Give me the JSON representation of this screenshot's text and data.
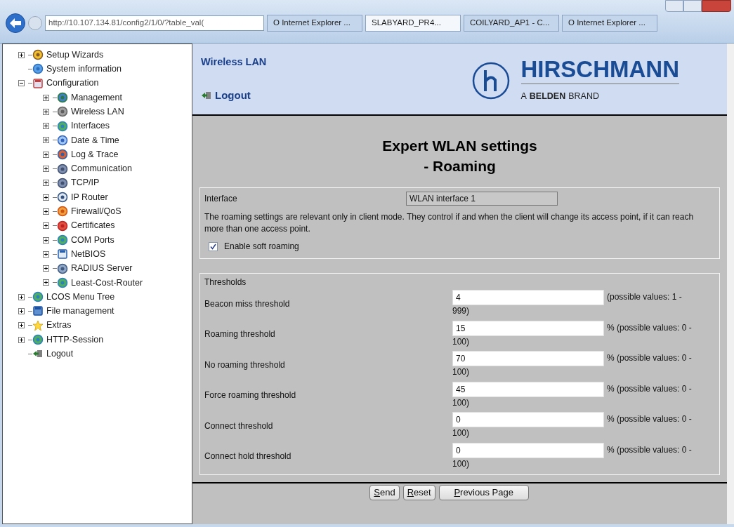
{
  "browser": {
    "address": "http://10.107.134.81/config2/1/0/?table_val(",
    "tabs": [
      {
        "label": "O Internet Explorer ...",
        "selected": false
      },
      {
        "label": "SLABYARD_PR4...",
        "selected": true
      },
      {
        "label": "COILYARD_AP1 - C...",
        "selected": false
      },
      {
        "label": "O Internet Explorer ...",
        "selected": false
      }
    ]
  },
  "sidebar": {
    "items": [
      {
        "label": "Setup Wizards",
        "expanded": false
      },
      {
        "label": "System information"
      },
      {
        "label": "Configuration",
        "expanded": true,
        "children": [
          {
            "label": "Management",
            "expanded": false
          },
          {
            "label": "Wireless LAN",
            "expanded": false
          },
          {
            "label": "Interfaces",
            "expanded": false
          },
          {
            "label": "Date & Time",
            "expanded": false
          },
          {
            "label": "Log & Trace",
            "expanded": false
          },
          {
            "label": "Communication",
            "expanded": false
          },
          {
            "label": "TCP/IP",
            "expanded": false
          },
          {
            "label": "IP Router",
            "expanded": false
          },
          {
            "label": "Firewall/QoS",
            "expanded": false
          },
          {
            "label": "Certificates",
            "expanded": false
          },
          {
            "label": "COM Ports",
            "expanded": false
          },
          {
            "label": "NetBIOS",
            "expanded": false
          },
          {
            "label": "RADIUS Server",
            "expanded": false
          },
          {
            "label": "Least-Cost-Router",
            "expanded": false
          }
        ]
      },
      {
        "label": "LCOS Menu Tree",
        "expanded": false
      },
      {
        "label": "File management",
        "expanded": false
      },
      {
        "label": "Extras",
        "expanded": false
      },
      {
        "label": "HTTP-Session",
        "expanded": false
      },
      {
        "label": "Logout"
      }
    ]
  },
  "header": {
    "section": "Wireless LAN",
    "logout": "Logout",
    "brand": "HIRSCHMANN",
    "tagline_prefix": "A",
    "tagline_bold": "BELDEN",
    "tagline_suffix": "BRAND"
  },
  "page": {
    "title_line_1": "Expert WLAN settings",
    "title_line_2": "- Roaming",
    "interface": {
      "label": "Interface",
      "value": "WLAN interface 1"
    },
    "description": "The roaming settings are relevant only in client mode. They control if and when the client will change its access point, if it can reach more than one access point.",
    "soft_roaming": {
      "label": "Enable soft roaming",
      "checked": true
    },
    "thresholds": {
      "title": "Thresholds",
      "rows": [
        {
          "label": "Beacon miss threshold",
          "value": "4",
          "hint": "(possible values: 1 -",
          "hint_end": "999)"
        },
        {
          "label": "Roaming threshold",
          "value": "15",
          "hint": "% (possible values: 0 -",
          "hint_end": "100)"
        },
        {
          "label": "No roaming threshold",
          "value": "70",
          "hint": "% (possible values: 0 -",
          "hint_end": "100)"
        },
        {
          "label": "Force roaming threshold",
          "value": "45",
          "hint": "% (possible values: 0 -",
          "hint_end": "100)"
        },
        {
          "label": "Connect threshold",
          "value": "0",
          "hint": "% (possible values: 0 -",
          "hint_end": "100)"
        },
        {
          "label": "Connect hold threshold",
          "value": "0",
          "hint": "% (possible values: 0 -",
          "hint_end": "100)"
        }
      ]
    },
    "buttons": [
      "Send",
      "Reset",
      "Previous Page"
    ]
  }
}
